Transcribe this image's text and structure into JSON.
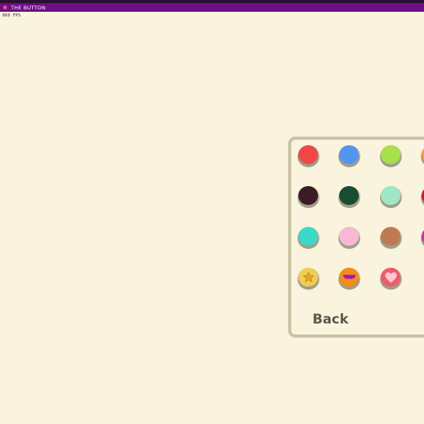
{
  "window": {
    "title": "THE BUTTON"
  },
  "overlay": {
    "fps": "860 FPS"
  },
  "skins_panel": {
    "back_label": "Back",
    "skins": [
      {
        "name": "red",
        "color": "#f04848",
        "rim": "#4a2a2a"
      },
      {
        "name": "blue",
        "color": "#5295ee",
        "rim": "#b7b5a5"
      },
      {
        "name": "lime",
        "color": "#a6e04a",
        "rim": "#c5c3a6"
      },
      {
        "name": "orange-partial",
        "color": "#f0a040",
        "rim": "#c5c3a6"
      },
      {
        "name": "dark-plum",
        "color": "#3b1c24",
        "rim": "#c5c3a6"
      },
      {
        "name": "dark-green",
        "color": "#184d34",
        "rim": "#c5c3a6"
      },
      {
        "name": "mint",
        "color": "#9fe6c6",
        "rim": "#c5c3a6"
      },
      {
        "name": "crimson-partial",
        "color": "#c0202c",
        "rim": "#c5c3a6"
      },
      {
        "name": "turquoise",
        "color": "#3cd8c8",
        "rim": "#c5c3a6"
      },
      {
        "name": "pink",
        "color": "#f7b8d6",
        "rim": "#c5c3a6"
      },
      {
        "name": "copper",
        "color": "#c07a52",
        "rim": "#c5c3a6"
      },
      {
        "name": "magenta-partial",
        "color": "#c03c8c",
        "rim": "#c5c3a6"
      },
      {
        "name": "star",
        "color": "#f2cc54",
        "rim": "#c5c3a6",
        "glyph": "star-icon"
      },
      {
        "name": "bat",
        "color": "#f58c14",
        "rim": "#c5c3a6",
        "glyph": "bat-icon"
      },
      {
        "name": "heart",
        "color": "#f05a6a",
        "rim": "#c5c3a6",
        "glyph": "heart-icon"
      }
    ]
  }
}
